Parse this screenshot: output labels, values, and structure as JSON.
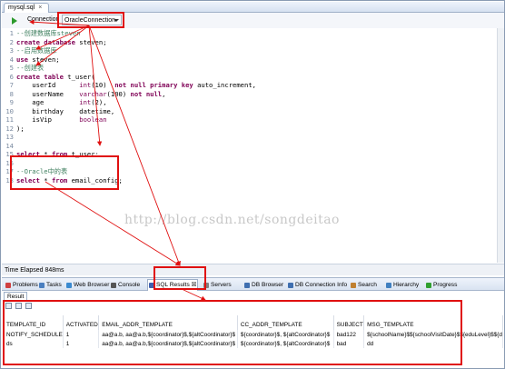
{
  "editor_tab": {
    "title": "mysql.sql",
    "close": "×"
  },
  "toolbar": {
    "connection_label": "Connection",
    "connection_value": "OracleConnection"
  },
  "code_lines": [
    {
      "n": "1",
      "parts": [
        {
          "t": "--创建数据库steven",
          "c": "cm"
        }
      ]
    },
    {
      "n": "2",
      "parts": [
        {
          "t": "create database ",
          "c": "kw"
        },
        {
          "t": "steven;",
          "c": ""
        }
      ]
    },
    {
      "n": "3",
      "parts": [
        {
          "t": "--启用数据库",
          "c": "cm"
        }
      ]
    },
    {
      "n": "4",
      "parts": [
        {
          "t": "use ",
          "c": "kw"
        },
        {
          "t": "steven;",
          "c": ""
        }
      ]
    },
    {
      "n": "5",
      "parts": [
        {
          "t": "--创建表",
          "c": "cm"
        }
      ]
    },
    {
      "n": "6",
      "parts": [
        {
          "t": "create table ",
          "c": "kw"
        },
        {
          "t": "t_user(",
          "c": ""
        }
      ]
    },
    {
      "n": "7",
      "parts": [
        {
          "t": "    userId      ",
          "c": ""
        },
        {
          "t": "int",
          "c": "ty"
        },
        {
          "t": "(10)  ",
          "c": ""
        },
        {
          "t": "not null primary key ",
          "c": "kw"
        },
        {
          "t": "auto_increment,",
          "c": ""
        }
      ]
    },
    {
      "n": "8",
      "parts": [
        {
          "t": "    userName    ",
          "c": ""
        },
        {
          "t": "varchar",
          "c": "ty"
        },
        {
          "t": "(100) ",
          "c": ""
        },
        {
          "t": "not null",
          "c": "kw"
        },
        {
          "t": ",",
          "c": ""
        }
      ]
    },
    {
      "n": "9",
      "parts": [
        {
          "t": "    age         ",
          "c": ""
        },
        {
          "t": "int",
          "c": "ty"
        },
        {
          "t": "(2),",
          "c": ""
        }
      ]
    },
    {
      "n": "10",
      "parts": [
        {
          "t": "    birthday    ",
          "c": ""
        },
        {
          "t": "datetime,",
          "c": ""
        }
      ]
    },
    {
      "n": "11",
      "parts": [
        {
          "t": "    isVip       ",
          "c": ""
        },
        {
          "t": "boolean",
          "c": "ty"
        }
      ]
    },
    {
      "n": "12",
      "parts": [
        {
          "t": ");",
          "c": ""
        }
      ]
    },
    {
      "n": "13",
      "parts": []
    },
    {
      "n": "14",
      "parts": []
    },
    {
      "n": "15",
      "parts": [
        {
          "t": "select ",
          "c": "kw"
        },
        {
          "t": "* ",
          "c": ""
        },
        {
          "t": "from ",
          "c": "kw"
        },
        {
          "t": "t_user;",
          "c": ""
        }
      ]
    },
    {
      "n": "16",
      "parts": []
    },
    {
      "n": "17",
      "parts": [
        {
          "t": "--Oracle中的表",
          "c": "cm"
        }
      ]
    },
    {
      "n": "18",
      "parts": [
        {
          "t": "select ",
          "c": "kw"
        },
        {
          "t": "* ",
          "c": ""
        },
        {
          "t": "from ",
          "c": "kw"
        },
        {
          "t": "email_config;",
          "c": ""
        }
      ]
    }
  ],
  "watermark": "http://blog.csdn.net/songdeitao",
  "status": {
    "elapsed": "Time Elapsed 848ms"
  },
  "view_tabs": [
    {
      "label": "Problems",
      "color": "#d04040"
    },
    {
      "label": "Tasks",
      "color": "#4a7fc0"
    },
    {
      "label": "Web Browser",
      "color": "#3a8ad0"
    },
    {
      "label": "Console",
      "color": "#555555"
    },
    {
      "label": "SQL Results ☒",
      "color": "#4060b0",
      "active": true
    },
    {
      "label": "Servers",
      "color": "#808080"
    },
    {
      "label": "DB Browser",
      "color": "#3f6fb0"
    },
    {
      "label": "DB Connection Info",
      "color": "#3f6fb0"
    },
    {
      "label": "Search",
      "color": "#c08030"
    },
    {
      "label": "Hierarchy",
      "color": "#4080c0"
    },
    {
      "label": "Progress",
      "color": "#30a030"
    }
  ],
  "results": {
    "tab_label": "Result 1",
    "columns": [
      "TEMPLATE_ID",
      "ACTIVATED",
      "EMAIL_ADDR_TEMPLATE",
      "CC_ADDR_TEMPLATE",
      "SUBJECT",
      "MSG_TEMPLATE"
    ],
    "rows": [
      [
        "NOTIFY_SCHEDULE",
        "1",
        "aa@a.b, aa@a.b,${coordinator}$,${altCoordinator}$",
        "${coordinator}$, ${altCoordinator}$",
        "bad122",
        "${schoolName}$${schoolVisitDate}$${eduLevel}$${d"
      ],
      [
        "ds",
        "1",
        "aa@a.b, aa@a.b,${coordinator}$,${altCoordinator}$",
        "${coordinator}$, ${altCoordinator}$",
        "bad",
        "dd"
      ]
    ]
  }
}
